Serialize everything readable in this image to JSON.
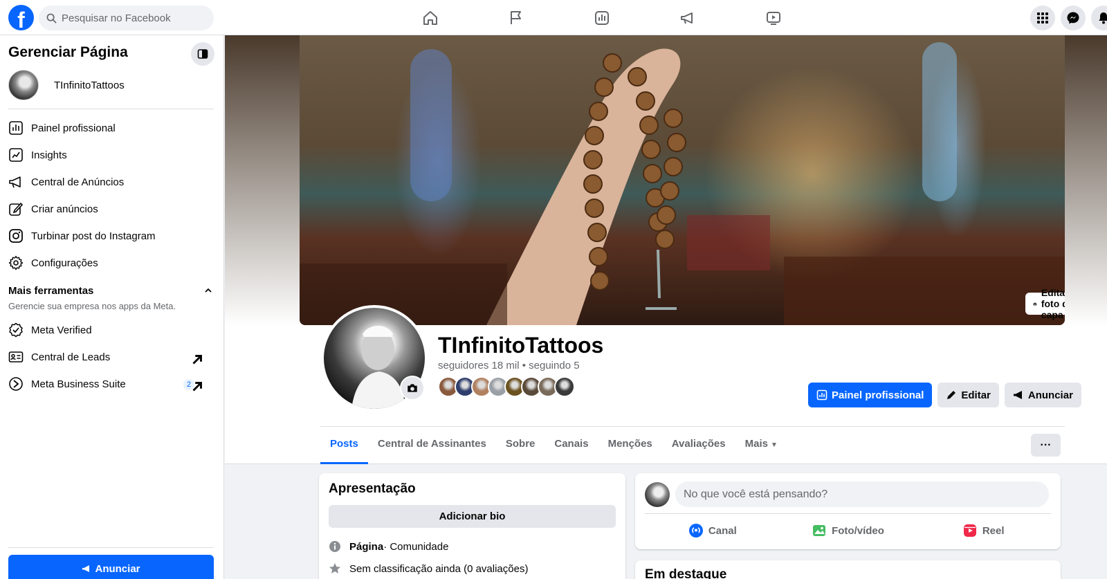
{
  "topbar": {
    "logo": "f",
    "search_placeholder": "Pesquisar no Facebook",
    "nav_icons": [
      "home-icon",
      "flag-icon",
      "insights-icon",
      "megaphone-icon",
      "video-icon"
    ],
    "right_icons": [
      "menu-grid-icon",
      "messenger-icon",
      "notifications-icon"
    ]
  },
  "sidebar": {
    "title": "Gerenciar Página",
    "page_name": "TInfinitoTattoos",
    "items": [
      {
        "label": "Painel profissional",
        "icon": "dashboard-icon"
      },
      {
        "label": "Insights",
        "icon": "insights-icon"
      },
      {
        "label": "Central de Anúncios",
        "icon": "megaphone-icon"
      },
      {
        "label": "Criar anúncios",
        "icon": "edit-icon"
      },
      {
        "label": "Turbinar post do Instagram",
        "icon": "instagram-icon"
      },
      {
        "label": "Configurações",
        "icon": "gear-icon"
      }
    ],
    "section_title": "Mais ferramentas",
    "section_subtitle": "Gerencie sua empresa nos apps da Meta.",
    "tools": [
      {
        "label": "Meta Verified",
        "icon": "verified-icon"
      },
      {
        "label": "Central de Leads",
        "icon": "id-card-icon"
      },
      {
        "label": "Meta Business Suite",
        "icon": "meta-icon",
        "badge": "2"
      }
    ],
    "bottom_button": "Anunciar"
  },
  "profile": {
    "cover_button": "Editar foto da capa",
    "name": "TInfinitoTattoos",
    "stats": "seguidores 18 mil • seguindo 5",
    "follower_colors": [
      "#8a5a3c",
      "#2f3e6b",
      "#b08060",
      "#9aa0a6",
      "#6b5220",
      "#5a4a3a",
      "#7a6a5a",
      "#3a3a3a"
    ],
    "actions": {
      "dashboard": "Painel profissional",
      "edit": "Editar",
      "advertise": "Anunciar"
    },
    "more_dots": "···"
  },
  "tabs": [
    {
      "label": "Posts",
      "active": true
    },
    {
      "label": "Central de Assinantes"
    },
    {
      "label": "Sobre"
    },
    {
      "label": "Canais"
    },
    {
      "label": "Menções"
    },
    {
      "label": "Avaliações"
    },
    {
      "label": "Mais"
    }
  ],
  "intro": {
    "title": "Apresentação",
    "bio_button": "Adicionar bio",
    "page_type_bold": "Página",
    "page_type_rest": " · Comunidade",
    "rating": "Sem classificação ainda (0 avaliações)"
  },
  "composer": {
    "placeholder": "No que você está pensando?",
    "actions": [
      "Canal",
      "Foto/vídeo",
      "Reel"
    ]
  },
  "highlights": {
    "title": "Em destaque"
  },
  "colors": {
    "accent": "#0866ff",
    "bg": "#f0f2f5"
  }
}
